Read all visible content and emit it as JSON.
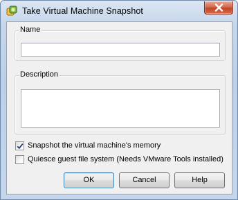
{
  "window": {
    "title": "Take Virtual Machine Snapshot",
    "icon": "vm-snapshot-icon",
    "close_icon": "close-icon"
  },
  "form": {
    "name_group_label": "Name",
    "name_value": "",
    "description_group_label": "Description",
    "description_value": "",
    "memory_checkbox": {
      "label": "Snapshot the virtual machine's memory",
      "checked": true
    },
    "quiesce_checkbox": {
      "label": "Quiesce guest file system (Needs VMware Tools installed)",
      "checked": false
    }
  },
  "buttons": {
    "ok": "OK",
    "cancel": "Cancel",
    "help": "Help"
  },
  "colors": {
    "title_bar": "#c5d6ec",
    "close_button": "#c0452a",
    "client_background": "#f0f0f0",
    "default_button_border": "#3c7fb1"
  }
}
